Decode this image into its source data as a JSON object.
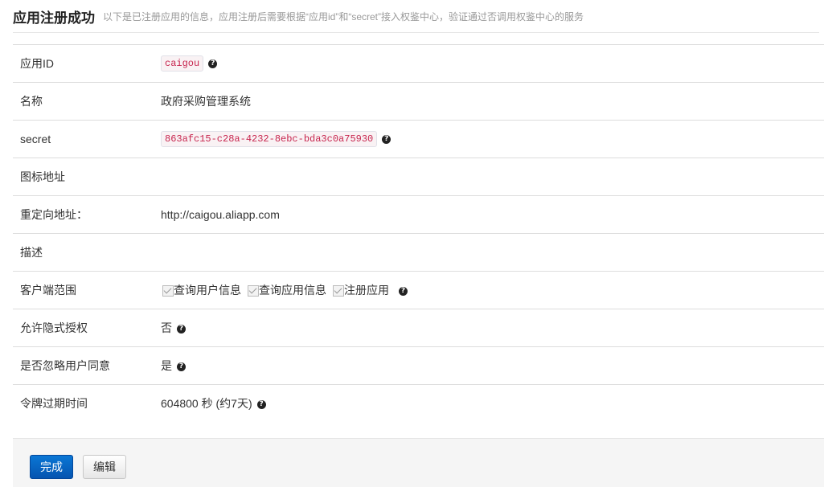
{
  "header": {
    "title": "应用注册成功",
    "subtitle": "以下是已注册应用的信息，应用注册后需要根据“应用id”和“secret”接入权鉴中心，验证通过否调用权鉴中心的服务"
  },
  "rows": {
    "app_id": {
      "label": "应用ID",
      "value": "caigou"
    },
    "name": {
      "label": "名称",
      "value": "政府采购管理系统"
    },
    "secret": {
      "label": "secret",
      "value": "863afc15-c28a-4232-8ebc-bda3c0a75930"
    },
    "icon_url": {
      "label": "图标地址",
      "value": ""
    },
    "redirect_url": {
      "label": "重定向地址：",
      "value": "http://caigou.aliapp.com"
    },
    "description": {
      "label": "描述",
      "value": ""
    },
    "client_scope": {
      "label": "客户端范围",
      "options": [
        {
          "label": "查询用户信息",
          "checked": true
        },
        {
          "label": "查询应用信息",
          "checked": true
        },
        {
          "label": "注册应用",
          "checked": true
        }
      ]
    },
    "implicit_grant": {
      "label": "允许隐式授权",
      "value": "否"
    },
    "skip_consent": {
      "label": "是否忽略用户同意",
      "value": "是"
    },
    "token_expiry": {
      "label": "令牌过期时间",
      "value": "604800 秒 (约7天)"
    }
  },
  "buttons": {
    "done": "完成",
    "edit": "编辑"
  },
  "icons": {
    "help": "question-circle-icon",
    "checkbox": "checkbox-checked-icon"
  },
  "colors": {
    "primary": "#0a6ad0",
    "code_text": "#c7254e"
  }
}
